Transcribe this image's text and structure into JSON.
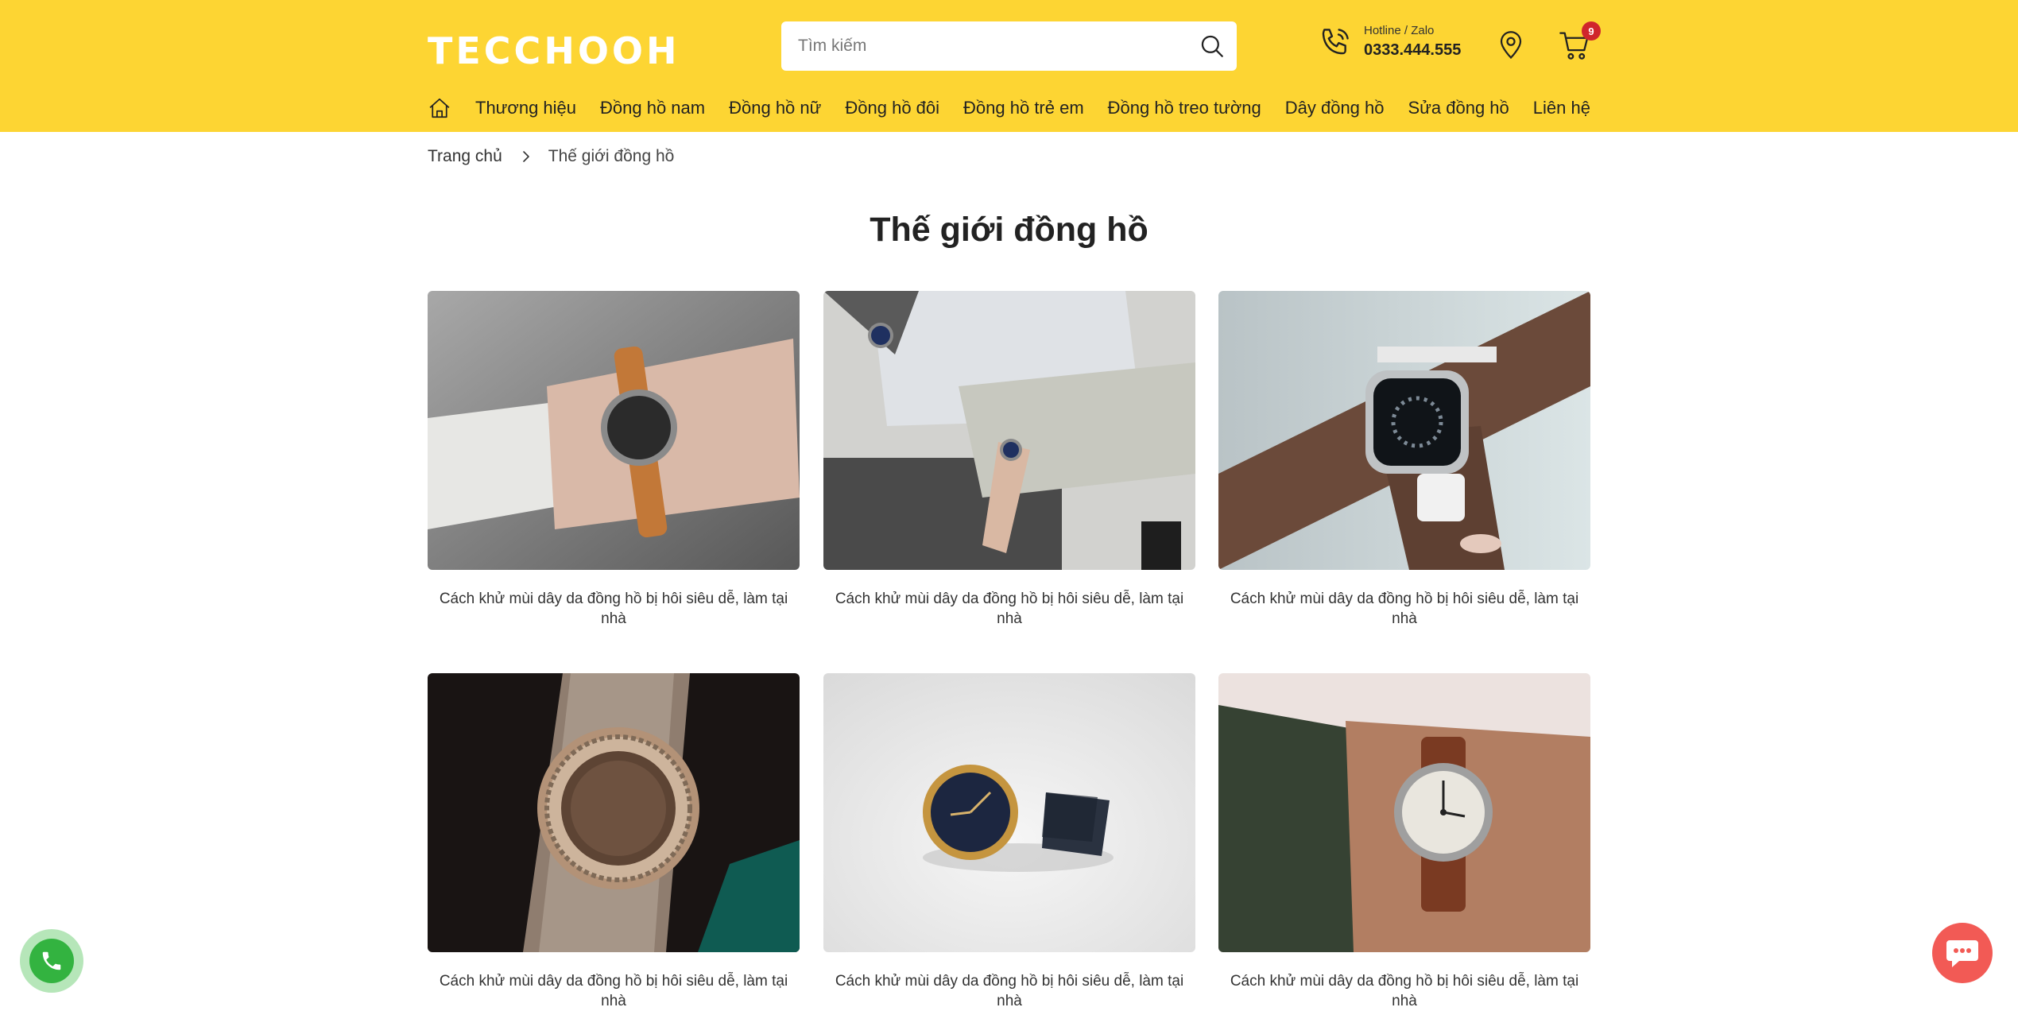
{
  "header": {
    "logo": "TECCHOOH",
    "search": {
      "placeholder": "Tìm kiếm"
    },
    "hotline": {
      "label": "Hotline / Zalo",
      "number": "0333.444.555"
    },
    "cart": {
      "count": "9"
    }
  },
  "nav": {
    "items": [
      {
        "label": "Thương hiệu"
      },
      {
        "label": "Đồng hồ nam"
      },
      {
        "label": "Đồng hồ nữ"
      },
      {
        "label": "Đồng hồ đôi"
      },
      {
        "label": "Đồng hồ trẻ em"
      },
      {
        "label": "Đồng hồ treo tường"
      },
      {
        "label": "Dây đồng hồ"
      },
      {
        "label": "Sửa đồng hồ"
      },
      {
        "label": "Liên hệ"
      }
    ]
  },
  "breadcrumb": {
    "home": "Trang chủ",
    "current": "Thế giới đồng hồ"
  },
  "page": {
    "title": "Thế giới đồng hồ"
  },
  "articles": [
    {
      "title": "Cách khử mùi dây da đồng hồ bị hôi siêu dễ, làm tại nhà"
    },
    {
      "title": "Cách khử mùi dây da đồng hồ bị hôi siêu dễ, làm tại nhà"
    },
    {
      "title": "Cách khử mùi dây da đồng hồ bị hôi siêu dễ, làm tại nhà"
    },
    {
      "title": "Cách khử mùi dây da đồng hồ bị hôi siêu dễ, làm tại nhà"
    },
    {
      "title": "Cách khử mùi dây da đồng hồ bị hôi siêu dễ, làm tại nhà"
    },
    {
      "title": "Cách khử mùi dây da đồng hồ bị hôi siêu dễ, làm tại nhà"
    }
  ],
  "colors": {
    "header_bg": "#fdd533",
    "badge": "#d0262c",
    "phone_fab": "#33b340",
    "chat_fab": "#f25a55"
  }
}
